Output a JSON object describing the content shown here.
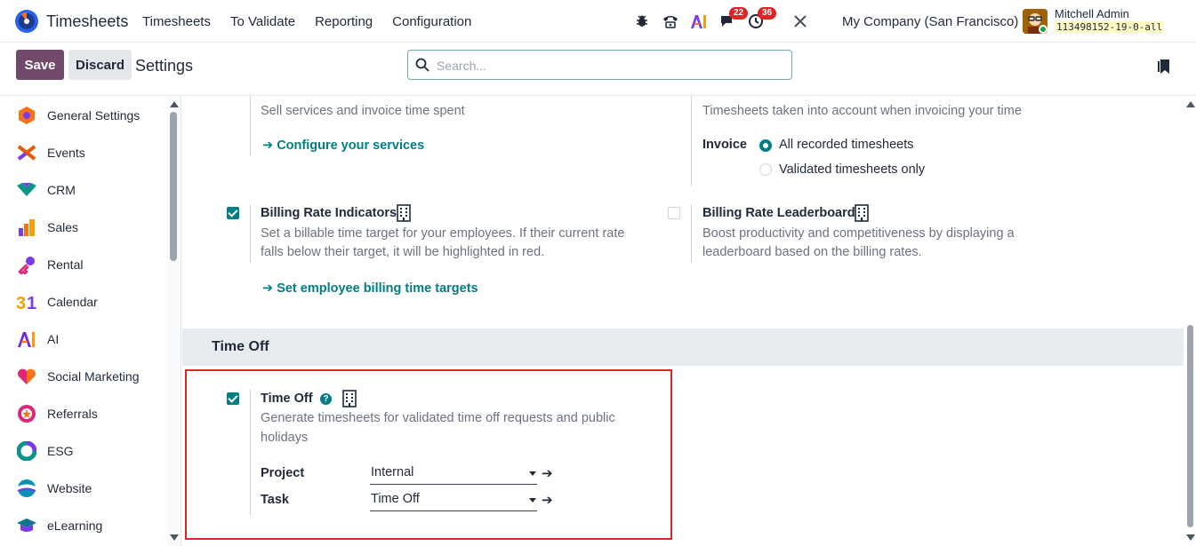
{
  "navbar": {
    "app_name": "Timesheets",
    "menu": [
      "Timesheets",
      "To Validate",
      "Reporting",
      "Configuration"
    ],
    "messages_count": "22",
    "activities_count": "36",
    "company": "My Company (San Francisco)",
    "user_name": "Mitchell Admin",
    "database": "113498152-19-0-all"
  },
  "control": {
    "save_label": "Save",
    "discard_label": "Discard",
    "title": "Settings",
    "search_placeholder": "Search..."
  },
  "sidebar": {
    "items": [
      {
        "label": "General Settings",
        "icon": "general-settings-icon",
        "color": "#f97316"
      },
      {
        "label": "Events",
        "icon": "events-icon",
        "color": "#ea580c"
      },
      {
        "label": "CRM",
        "icon": "crm-icon",
        "color": "#0d9488"
      },
      {
        "label": "Sales",
        "icon": "sales-icon",
        "color": "#f59e0b"
      },
      {
        "label": "Rental",
        "icon": "rental-icon",
        "color": "#7c3aed"
      },
      {
        "label": "Calendar",
        "icon": "calendar-icon",
        "color": "#f59e0b"
      },
      {
        "label": "AI",
        "icon": "ai-icon",
        "color": "#6d28d9"
      },
      {
        "label": "Social Marketing",
        "icon": "social-marketing-icon",
        "color": "#f97316"
      },
      {
        "label": "Referrals",
        "icon": "referrals-icon",
        "color": "#db2777"
      },
      {
        "label": "ESG",
        "icon": "esg-icon",
        "color": "#0d9488"
      },
      {
        "label": "Website",
        "icon": "website-icon",
        "color": "#0891b2"
      },
      {
        "label": "eLearning",
        "icon": "elearning-icon",
        "color": "#0e7490"
      }
    ]
  },
  "main": {
    "services": {
      "description": "Sell services and invoice time spent",
      "link": "Configure your services"
    },
    "invoicing": {
      "description": "Timesheets taken into account when invoicing your time",
      "invoice_label": "Invoice",
      "options": [
        "All recorded timesheets",
        "Validated timesheets only"
      ],
      "selected_index": 0
    },
    "billing_rate_indicators": {
      "title": "Billing Rate Indicators",
      "checked": true,
      "desc_line1": "Set a billable time target for your employees. If their current rate",
      "desc_line2": "falls below their target, it will be highlighted in red.",
      "link": "Set employee billing time targets"
    },
    "billing_rate_leaderboard": {
      "title": "Billing Rate Leaderboard",
      "checked": false,
      "desc_line1": "Boost productivity and competitiveness by displaying a",
      "desc_line2": "leaderboard based on the billing rates."
    },
    "time_off_section": {
      "heading": "Time Off",
      "setting_title": "Time Off",
      "checked": true,
      "desc_line1": "Generate timesheets for validated time off requests and public",
      "desc_line2": "holidays",
      "project_label": "Project",
      "project_value": "Internal",
      "task_label": "Task",
      "task_value": "Time Off"
    }
  },
  "colors": {
    "brand": "#71496a",
    "accent": "#017e84",
    "highlight": "#dc2626"
  }
}
